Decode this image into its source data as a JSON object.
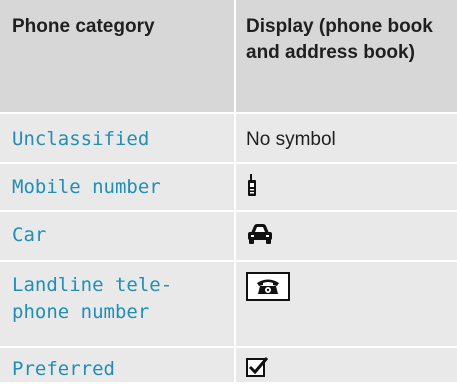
{
  "table": {
    "headers": [
      "Phone category",
      "Display (phone book and address book)"
    ],
    "rows": [
      {
        "category": "Unclassified",
        "display_text": "No symbol",
        "icon": ""
      },
      {
        "category": "Mobile number",
        "display_text": "",
        "icon": "mobile-phone-icon"
      },
      {
        "category": "Car",
        "display_text": "",
        "icon": "car-icon"
      },
      {
        "category": "Landline tele-\nphone number",
        "display_text": "",
        "icon": "landline-phone-icon"
      },
      {
        "category": "Preferred",
        "display_text": "",
        "icon": "checkbox-checked-icon"
      }
    ]
  },
  "colors": {
    "header_bg": "#d7d7d7",
    "row_bg": "#e9e9e9",
    "category_text": "#1f8fb8"
  }
}
